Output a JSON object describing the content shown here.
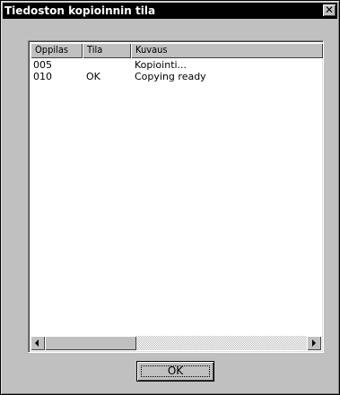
{
  "window": {
    "title": "Tiedoston kopioinnin tila",
    "close_label": "✕"
  },
  "list": {
    "columns": [
      "Oppilas",
      "Tila",
      "Kuvaus"
    ],
    "rows": [
      [
        "005",
        "",
        "Kopiointi..."
      ],
      [
        "010",
        "OK",
        "Copying ready"
      ]
    ]
  },
  "buttons": {
    "ok_label": "OK"
  },
  "icons": {
    "close": "close-icon",
    "scroll_left": "arrow-left-icon",
    "scroll_right": "arrow-right-icon"
  }
}
